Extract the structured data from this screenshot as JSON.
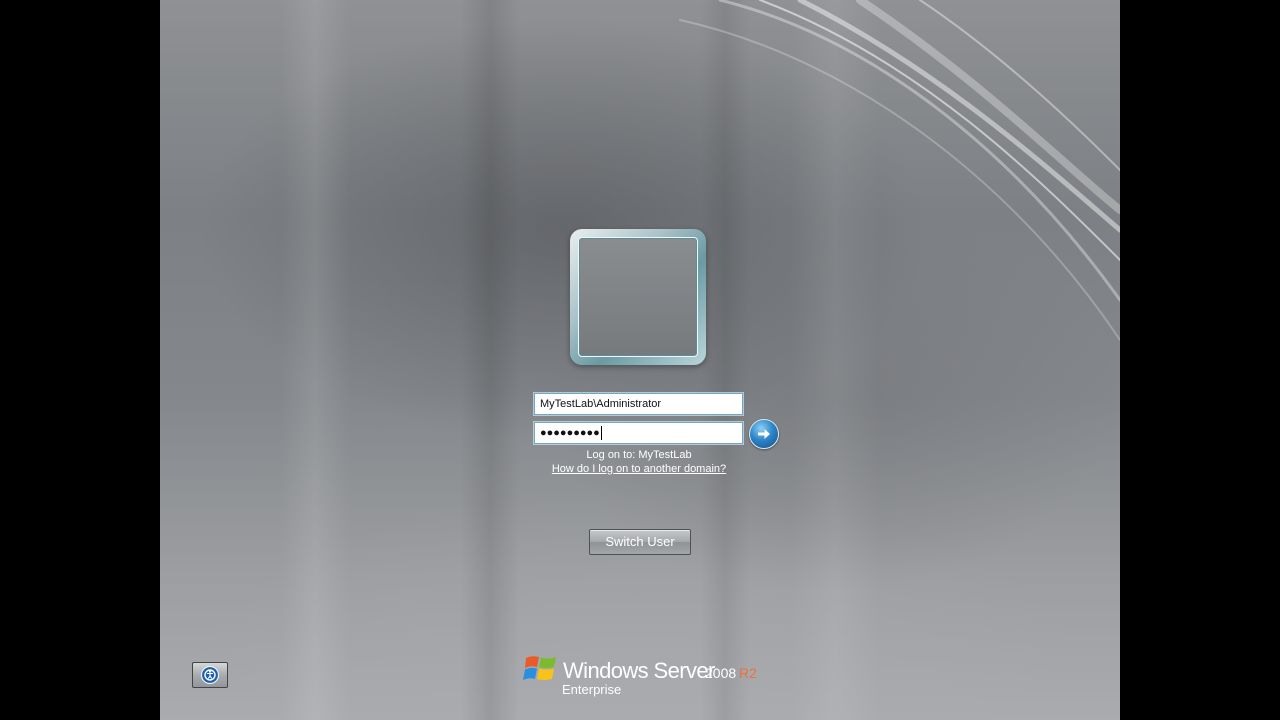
{
  "login": {
    "username_value": "MyTestLab\\Administrator",
    "password_mask": "●●●●●●●●●",
    "logon_to_text": "Log on to: MyTestLab",
    "domain_help_link": "How do I log on to another domain?",
    "switch_user_label": "Switch User"
  },
  "branding": {
    "product": "Windows Server",
    "version": "2008",
    "release": "R2",
    "edition": "Enterprise"
  },
  "icons": {
    "submit": "arrow-right-circle-icon",
    "ease_of_access": "ease-of-access-icon",
    "logo": "windows-flag-icon"
  },
  "colors": {
    "accent_blue": "#2d86c9",
    "r2_orange": "#e8743a",
    "field_border": "#6fa7c9"
  }
}
